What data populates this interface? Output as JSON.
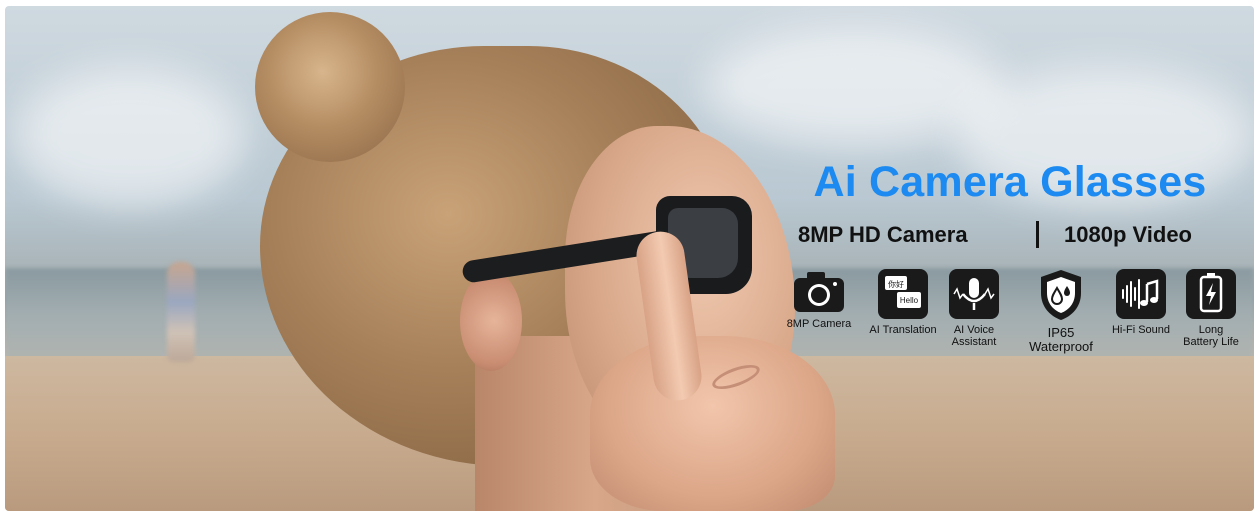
{
  "banner": {
    "title": "Ai Camera Glasses",
    "spec_left": "8MP HD Camera",
    "spec_right": "1080p Video",
    "title_color": "#1c8af0",
    "features": [
      {
        "icon": "camera-icon",
        "label": "8MP Camera"
      },
      {
        "icon": "translation-icon",
        "label": "AI Translation",
        "icon_text_top": "你好",
        "icon_text_bottom": "Hello"
      },
      {
        "icon": "microphone-icon",
        "label": "AI Voice\nAssistant"
      },
      {
        "icon": "waterproof-shield-icon",
        "label": "IP65\nWaterproof"
      },
      {
        "icon": "music-icon",
        "label": "Hi-Fi Sound"
      },
      {
        "icon": "battery-icon",
        "label": "Long\nBattery Life"
      }
    ]
  }
}
